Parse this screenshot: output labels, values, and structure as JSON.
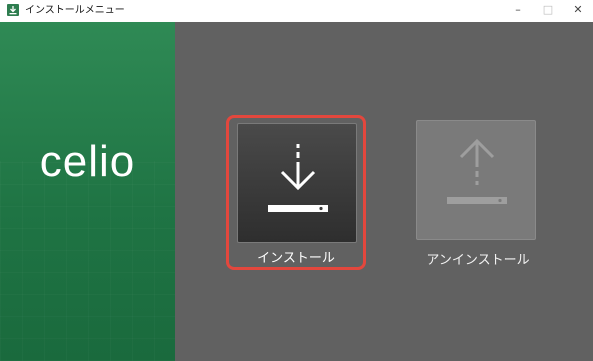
{
  "window": {
    "title": "インストールメニュー",
    "minimize_glyph": "–",
    "maximize_glyph": "□",
    "close_glyph": "✕"
  },
  "sidebar": {
    "logo_text": "celio",
    "background_color": "#1f7444"
  },
  "options": [
    {
      "label": "インストール",
      "icon": "download-icon",
      "selected": true,
      "enabled": true
    },
    {
      "label": "アンインストール",
      "icon": "upload-icon",
      "selected": false,
      "enabled": false
    }
  ],
  "colors": {
    "content_bg": "#616161",
    "selection_border": "#e3473d"
  }
}
